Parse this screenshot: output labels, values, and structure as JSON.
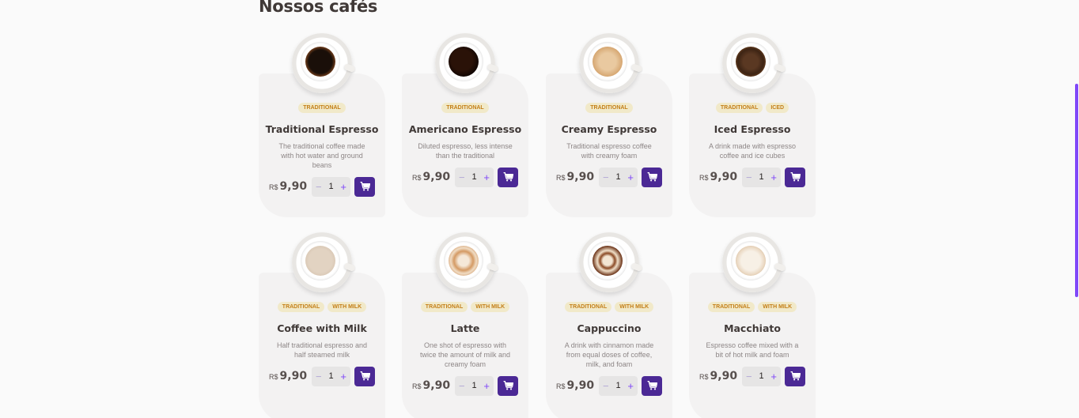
{
  "section": {
    "title": "Nossos cafés"
  },
  "currency": "R$",
  "products": [
    {
      "name": "Traditional Espresso",
      "description": "The traditional coffee made with hot water and ground beans",
      "tags": [
        "TRADITIONAL"
      ],
      "price": "9,90",
      "quantity": "1",
      "cup": "espresso"
    },
    {
      "name": "Americano Espresso",
      "description": "Diluted espresso, less intense than the traditional",
      "tags": [
        "TRADITIONAL"
      ],
      "price": "9,90",
      "quantity": "1",
      "cup": "americano"
    },
    {
      "name": "Creamy Espresso",
      "description": "Traditional espresso coffee with creamy foam",
      "tags": [
        "TRADITIONAL"
      ],
      "price": "9,90",
      "quantity": "1",
      "cup": "creamy"
    },
    {
      "name": "Iced Espresso",
      "description": "A drink made with espresso coffee and ice cubes",
      "tags": [
        "TRADITIONAL",
        "ICED"
      ],
      "price": "9,90",
      "quantity": "1",
      "cup": "iced"
    },
    {
      "name": "Coffee with Milk",
      "description": "Half traditional espresso and half steamed milk",
      "tags": [
        "TRADITIONAL",
        "WITH MILK"
      ],
      "price": "9,90",
      "quantity": "1",
      "cup": "milk"
    },
    {
      "name": "Latte",
      "description": "One shot of espresso with twice the amount of milk and creamy foam",
      "tags": [
        "TRADITIONAL",
        "WITH MILK"
      ],
      "price": "9,90",
      "quantity": "1",
      "cup": "latte"
    },
    {
      "name": "Cappuccino",
      "description": "A drink with cinnamon made from equal doses of coffee, milk, and foam",
      "tags": [
        "TRADITIONAL",
        "WITH MILK"
      ],
      "price": "9,90",
      "quantity": "1",
      "cup": "cappuccino"
    },
    {
      "name": "Macchiato",
      "description": "Espresso coffee mixed with a bit of hot milk and foam",
      "tags": [
        "TRADITIONAL",
        "WITH MILK"
      ],
      "price": "9,90",
      "quantity": "1",
      "cup": "macchiato"
    }
  ],
  "controls": {
    "minus": "−",
    "plus": "+"
  },
  "colors": {
    "accent": "#8047f8",
    "cart": "#4b2995",
    "tag_bg": "#f1e9c9",
    "tag_text": "#c47f17"
  },
  "icons": {
    "cart": "shopping-cart-icon"
  }
}
